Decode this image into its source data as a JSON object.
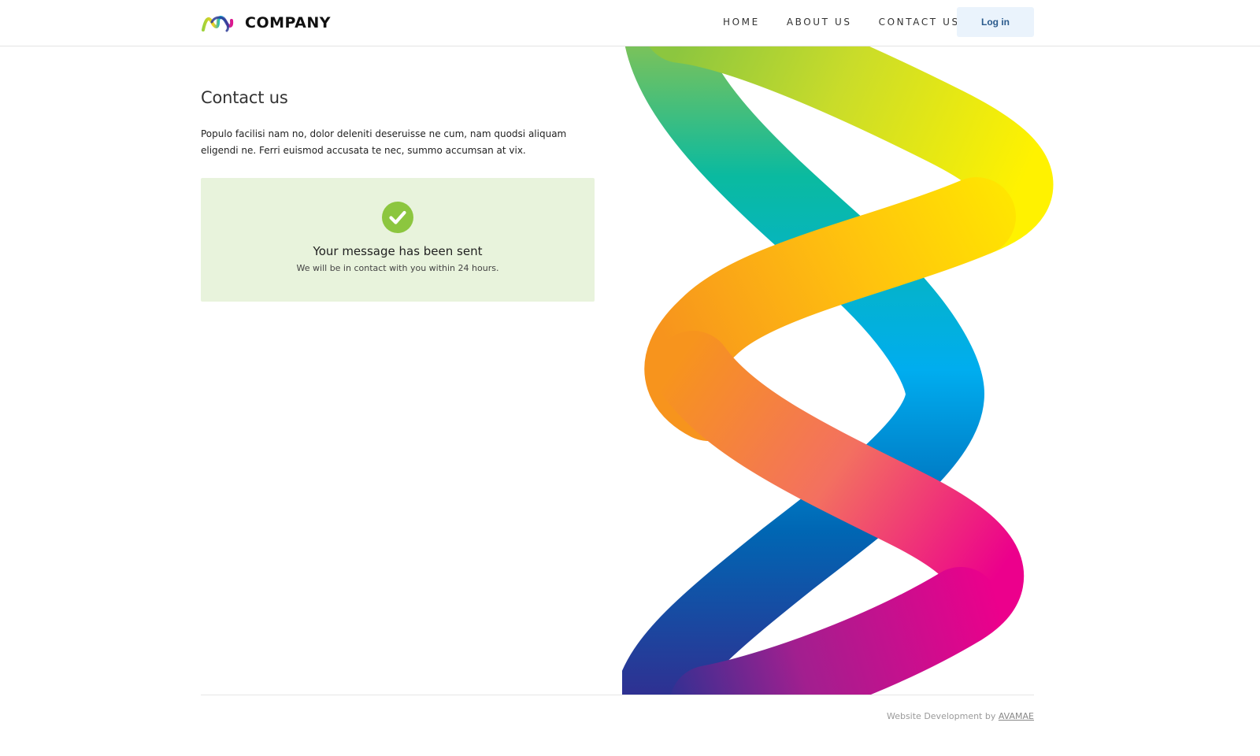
{
  "header": {
    "logo_text": "COMPANY",
    "nav": [
      {
        "label": "HOME"
      },
      {
        "label": "ABOUT US"
      },
      {
        "label": "CONTACT US"
      }
    ],
    "login_label": "Log in"
  },
  "main": {
    "title": "Contact us",
    "intro": "Populo facilisi nam no, dolor deleniti deseruisse ne cum, nam quodsi aliquam eligendi ne. Ferri euismod accusata te nec, summo accumsan at vix.",
    "success": {
      "icon": "check-circle-icon",
      "title": "Your message has been sent",
      "subtitle": "We will be in contact with you within 24 hours."
    }
  },
  "footer": {
    "credit_text": "Website Development by ",
    "credit_link": "AVAMAE"
  },
  "colors": {
    "success_bg": "#e8f3dc",
    "success_icon": "#8cc63f",
    "login_bg": "#eaf3fc",
    "login_text": "#2a5a8c"
  }
}
